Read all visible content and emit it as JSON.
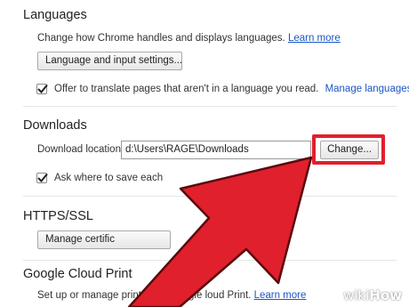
{
  "languages": {
    "title": "Languages",
    "description": "Change how Chrome handles and displays languages.",
    "learn_more": "Learn more",
    "settings_button": "Language and input settings...",
    "translate_checkbox_label": "Offer to translate pages that aren't in a language you read.",
    "translate_checked": true,
    "manage_languages": "Manage languages"
  },
  "downloads": {
    "title": "Downloads",
    "location_label": "Download location:",
    "location_value": "d:\\Users\\RAGE\\Downloads",
    "change_button": "Change...",
    "ask_checkbox_label": "Ask where to save each",
    "ask_checked": true
  },
  "https_ssl": {
    "title": "HTTPS/SSL",
    "manage_certificates_button": "Manage certific"
  },
  "cloud_print": {
    "title": "Google Cloud Print",
    "description_start": "Set up or manage printers in Google ",
    "description_end": "loud Print.",
    "learn_more": "Learn more"
  },
  "annotation": {
    "highlight_color": "#e0202c",
    "arrow_color": "#e0202c"
  },
  "watermark": {
    "wiki": "wiki",
    "how": "How"
  }
}
